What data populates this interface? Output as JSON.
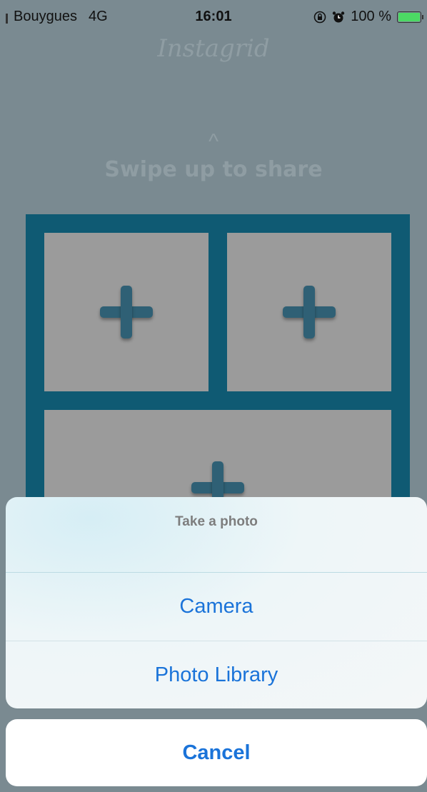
{
  "status_bar": {
    "carrier": "Bouygues",
    "network": "4G",
    "time": "16:01",
    "battery": "100 %",
    "battery_level": 1.0,
    "icons": [
      "signal-bars-icon",
      "screen-rotation-lock-icon",
      "alarm-icon",
      "battery-icon"
    ]
  },
  "app": {
    "title": "Instagrid",
    "swipe_arrow": "^",
    "swipe_label": "Swipe up to share"
  },
  "grid": {
    "cells": [
      {
        "icon": "plus-icon"
      },
      {
        "icon": "plus-icon"
      },
      {
        "icon": "plus-icon"
      }
    ]
  },
  "action_sheet": {
    "title": "Take a photo",
    "options": [
      {
        "label": "Camera"
      },
      {
        "label": "Photo Library"
      }
    ],
    "cancel_label": "Cancel"
  },
  "colors": {
    "background": "#7a8a91",
    "grid_frame": "#0f5a73",
    "grid_cell": "#9b9b9b",
    "plus": "#2f6075",
    "action_text": "#1a73d9",
    "battery_fill": "#4cd964"
  }
}
